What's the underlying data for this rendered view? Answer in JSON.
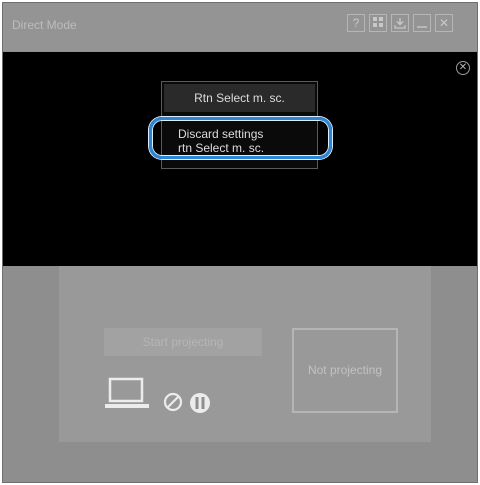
{
  "window": {
    "title": "Direct Mode"
  },
  "titlebar_buttons": [
    {
      "name": "help-button",
      "icon": "question-icon",
      "glyph": "?"
    },
    {
      "name": "grid-button",
      "icon": "grid-icon"
    },
    {
      "name": "download-button",
      "icon": "download-icon"
    },
    {
      "name": "minimize-button",
      "icon": "minimize-icon"
    },
    {
      "name": "close-button",
      "icon": "close-icon",
      "glyph": "✕"
    }
  ],
  "overlay": {
    "close_icon": "circle-close-icon",
    "close_glyph": "✕"
  },
  "menu": {
    "items": [
      {
        "label": "Rtn Select m. sc.",
        "highlighted": true
      },
      {
        "label_lines": [
          "Discard settings",
          "rtn Select m. sc."
        ]
      }
    ]
  },
  "panel": {
    "start_button_label": "Start projecting",
    "status_text": "Not projecting",
    "icons": [
      "laptop-icon",
      "no-signal-icon",
      "mute-icon"
    ]
  },
  "colors": {
    "accent_focus": "#2b86d6",
    "overlay": "#000000",
    "window_bg": "#8e8e8e"
  }
}
